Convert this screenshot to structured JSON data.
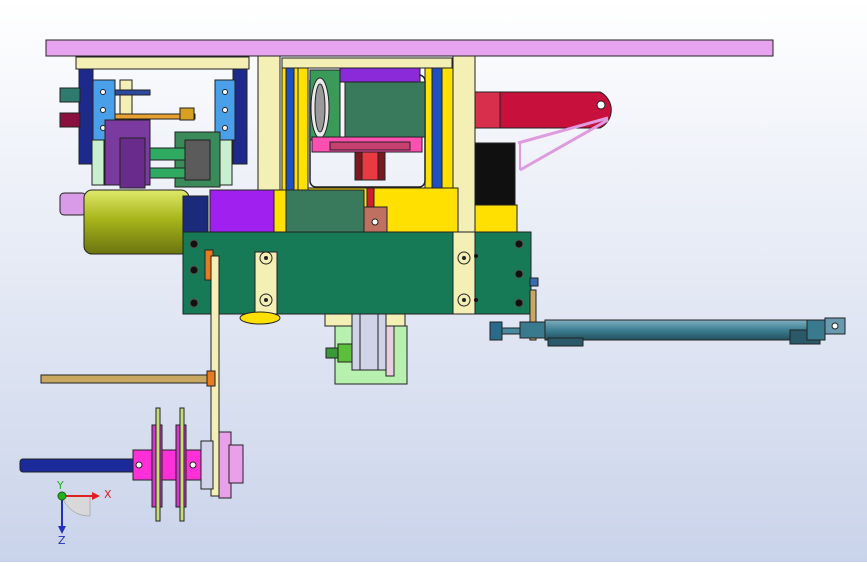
{
  "viewport": {
    "background_top": "#ffffff",
    "background_bottom": "#c9d3ea"
  },
  "triad": {
    "x_label": "X",
    "y_label": "Y",
    "z_label": "Z",
    "x_color": "#e02020",
    "y_color": "#20b020",
    "z_color": "#2030c0"
  }
}
